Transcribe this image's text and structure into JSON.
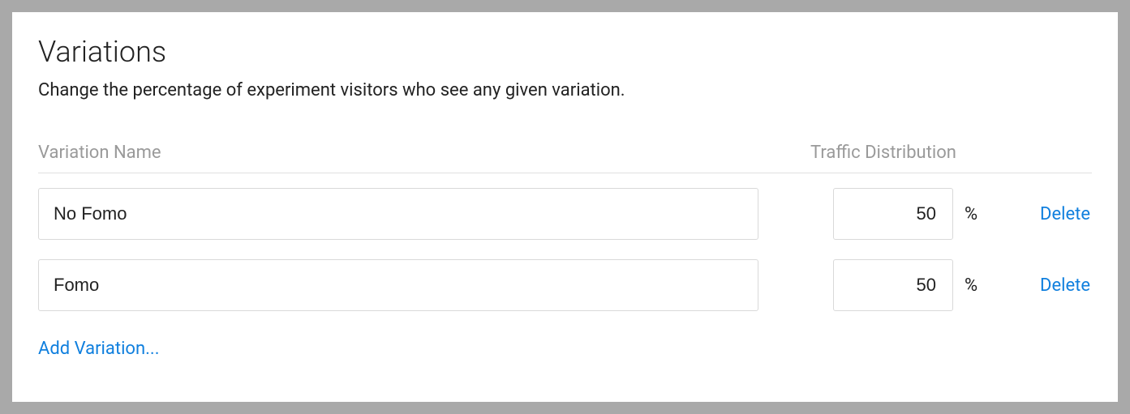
{
  "heading": "Variations",
  "description": "Change the percentage of experiment visitors who see any given variation.",
  "columns": {
    "name": "Variation Name",
    "traffic": "Traffic Distribution"
  },
  "percent_sign": "%",
  "delete_label": "Delete",
  "add_label": "Add Variation...",
  "variations": [
    {
      "name": "No Fomo",
      "traffic": "50"
    },
    {
      "name": "Fomo",
      "traffic": "50"
    }
  ]
}
